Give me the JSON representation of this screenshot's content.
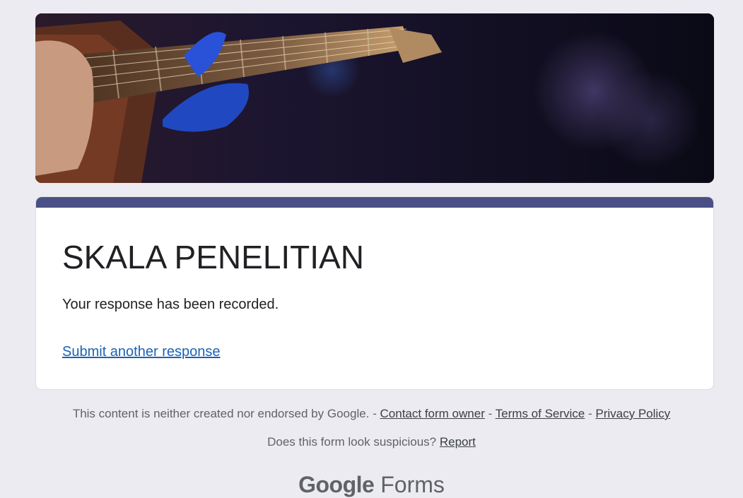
{
  "banner": {
    "image": "guitar-player-stage-photo"
  },
  "form": {
    "title": "SKALA PENELITIAN",
    "confirmation": "Your response has been recorded.",
    "another_link": "Submit another response",
    "accent_color": "#4a5085"
  },
  "footer": {
    "disclaimer": "This content is neither created nor endorsed by Google.",
    "sep1": " - ",
    "contact_link": "Contact form owner",
    "sep2": " - ",
    "terms_link": "Terms of Service",
    "sep3": " - ",
    "privacy_link": "Privacy Policy",
    "suspicious": "Does this form look suspicious?",
    "report_link": "Report"
  },
  "brand": {
    "google": "Google",
    "forms": "Forms"
  }
}
